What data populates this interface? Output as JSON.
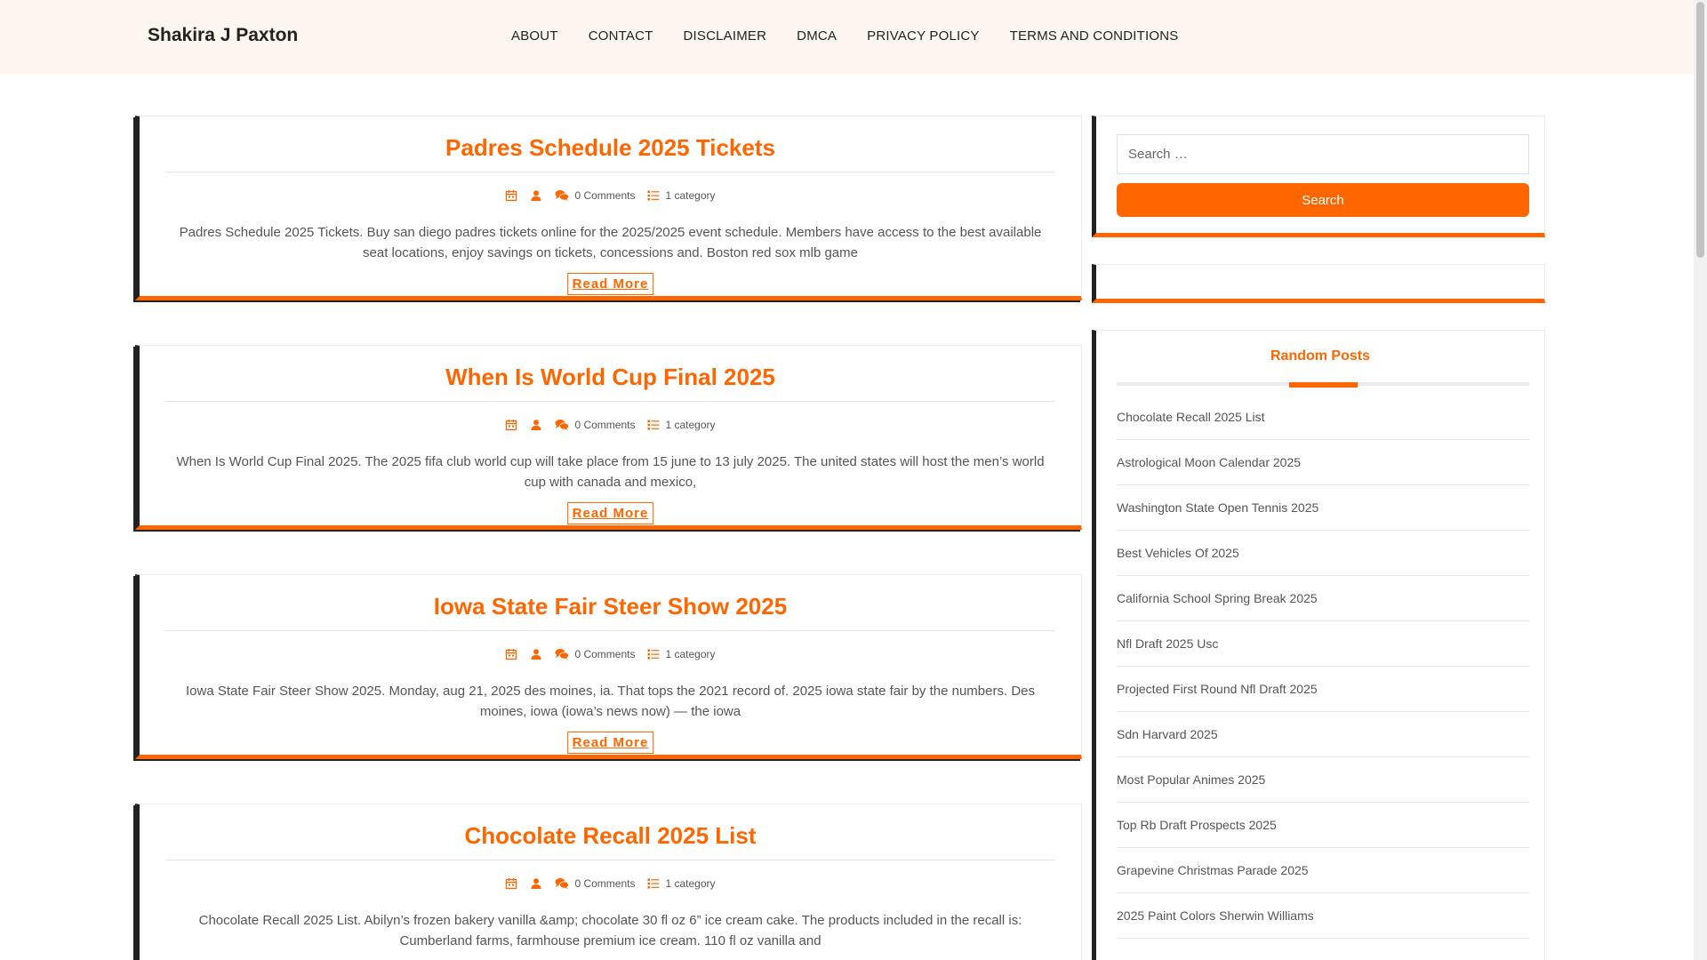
{
  "header": {
    "site_title": "Shakira J Paxton",
    "nav": [
      "ABOUT",
      "CONTACT",
      "DISCLAIMER",
      "DMCA",
      "PRIVACY POLICY",
      "TERMS AND CONDITIONS"
    ]
  },
  "colors": {
    "accent": "#ff6600",
    "header_bg": "#fdf6ee",
    "dark_border": "#222222"
  },
  "posts": [
    {
      "title": "Padres Schedule 2025 Tickets",
      "comments": "0 Comments",
      "category": "1 category",
      "excerpt": "Padres Schedule 2025 Tickets. Buy san diego padres tickets online for the 2025/2025 event schedule. Members have access to the best available seat locations, enjoy savings on tickets, concessions and. Boston red sox mlb game",
      "read_more": "Read More"
    },
    {
      "title": "When Is World Cup Final 2025",
      "comments": "0 Comments",
      "category": "1 category",
      "excerpt": "When Is World Cup Final 2025. The 2025 fifa club world cup will take place from 15 june to 13 july 2025. The united states will host the men’s world cup with canada and mexico,",
      "read_more": "Read More"
    },
    {
      "title": "Iowa State Fair Steer Show 2025",
      "comments": "0 Comments",
      "category": "1 category",
      "excerpt": "Iowa State Fair Steer Show 2025. Monday, aug 21, 2025 des moines, ia. That tops the 2021 record of. 2025 iowa state fair by the numbers. Des moines, iowa (iowa’s news now) — the iowa",
      "read_more": "Read More"
    },
    {
      "title": "Chocolate Recall 2025 List",
      "comments": "0 Comments",
      "category": "1 category",
      "excerpt": "Chocolate Recall 2025 List. Abilyn’s frozen bakery vanilla &amp; chocolate 30 fl oz 6” ice cream cake. The products included in the recall is: Cumberland farms, farmhouse premium ice cream. 110 fl oz vanilla and",
      "read_more": "Read More"
    }
  ],
  "meta_icons": [
    "calendar-icon",
    "user-icon",
    "comments-icon",
    "category-list-icon"
  ],
  "sidebar": {
    "search_placeholder": "Search …",
    "search_button": "Search",
    "random_title": "Random Posts",
    "random_posts": [
      "Chocolate Recall 2025 List",
      "Astrological Moon Calendar 2025",
      "Washington State Open Tennis 2025",
      "Best Vehicles Of 2025",
      "California School Spring Break 2025",
      "Nfl Draft 2025 Usc",
      "Projected First Round Nfl Draft 2025",
      "Sdn Harvard 2025",
      "Most Popular Animes 2025",
      "Top Rb Draft Prospects 2025",
      "Grapevine Christmas Parade 2025",
      "2025 Paint Colors Sherwin Williams"
    ]
  }
}
